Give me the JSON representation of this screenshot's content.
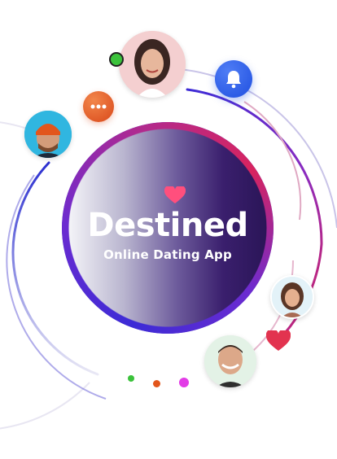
{
  "app": {
    "brand_name": "Destined",
    "tagline": "Online Dating App"
  },
  "icons": {
    "notification": "bell-icon",
    "chat": "chat-dots-icon",
    "like": "heart-icon",
    "online_status": "online-dot-icon"
  },
  "avatars": [
    {
      "name": "woman-top",
      "status": "online"
    },
    {
      "name": "man-orange-beanie"
    },
    {
      "name": "woman-right"
    },
    {
      "name": "man-bottom"
    }
  ],
  "colors": {
    "ring_start": "#3c2bd6",
    "ring_end": "#d7245f",
    "notification_blue": "#1f4fe0",
    "chat_orange": "#e2561c",
    "heart_red": "#e2334f",
    "online_green": "#3bc23b",
    "dot_magenta": "#e23ce6"
  }
}
